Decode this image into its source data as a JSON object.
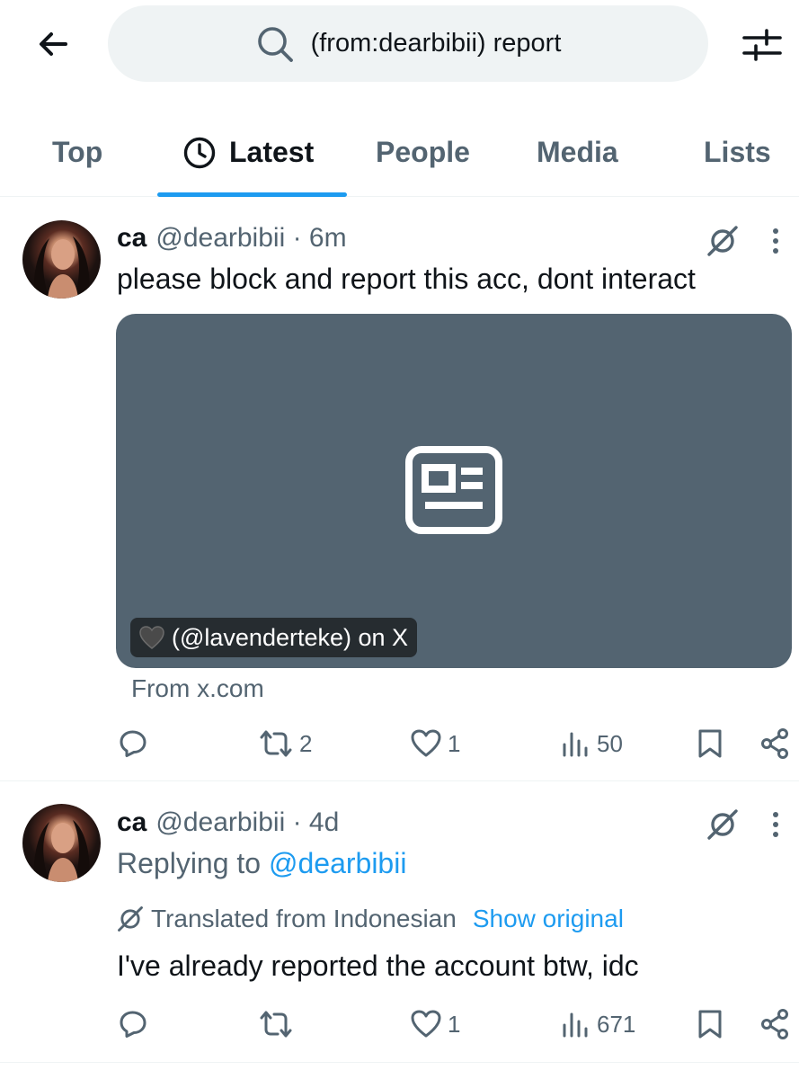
{
  "search": {
    "query": "(from:dearbibii) report",
    "icon": "search-icon"
  },
  "tabs": [
    {
      "label": "Top",
      "active": false
    },
    {
      "label": "Latest",
      "active": true,
      "icon": "clock-icon"
    },
    {
      "label": "People",
      "active": false
    },
    {
      "label": "Media",
      "active": false
    },
    {
      "label": "Lists",
      "active": false
    }
  ],
  "tweets": [
    {
      "name": "ca",
      "handle": "@dearbibii",
      "sep": " · ",
      "time": "6m",
      "text": "please block and report this acc, dont interact",
      "card": {
        "label": "(@lavenderteke) on X",
        "source": "From x.com",
        "background": "#536471"
      },
      "stats": {
        "replies": "",
        "retweets": "2",
        "likes": "1",
        "views": "50"
      }
    },
    {
      "name": "ca",
      "handle": "@dearbibii",
      "sep": " · ",
      "time": "4d",
      "replying_prefix": "Replying to ",
      "replying_handle": "@dearbibii",
      "translated_from": "Translated from Indonesian",
      "show_original": "Show original",
      "text": "I've already reported the account btw, idc",
      "stats": {
        "replies": "",
        "retweets": "",
        "likes": "1",
        "views": "671"
      }
    }
  ],
  "colors": {
    "accent": "#1d9bf0",
    "text": "#0f1419",
    "muted": "#536471",
    "search_bg": "#eff3f4"
  }
}
